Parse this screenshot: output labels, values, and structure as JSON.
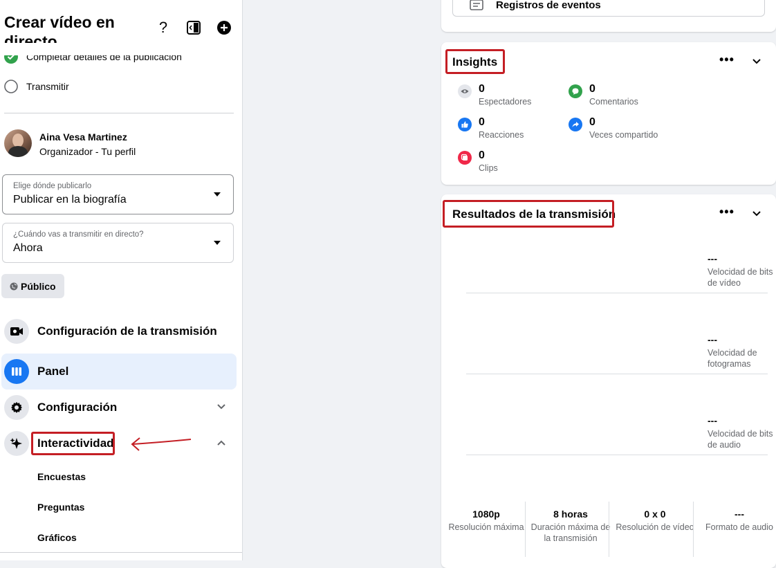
{
  "left": {
    "title_line1": "Crear vídeo en",
    "title_line2": "directo",
    "steps": {
      "completed": "Completar detalles de la publicación",
      "broadcast": "Transmitir"
    },
    "profile": {
      "name": "Aina Vesa Martinez",
      "role": "Organizador - Tu perfil"
    },
    "where": {
      "label": "Elige dónde publicarlo",
      "value": "Publicar en la biografía"
    },
    "when": {
      "label": "¿Cuándo vas a transmitir en directo?",
      "value": "Ahora"
    },
    "audience": "Público",
    "nav": {
      "stream_config": "Configuración de la transmisión",
      "panel": "Panel",
      "settings": "Configuración",
      "interactivity": "Interactividad"
    },
    "sub": {
      "polls": "Encuestas",
      "questions": "Preguntas",
      "graphics": "Gráficos"
    }
  },
  "top_card": {
    "label": "Registros de eventos"
  },
  "insights": {
    "title": "Insights",
    "items": {
      "viewers": {
        "value": "0",
        "label": "Espectadores"
      },
      "comments": {
        "value": "0",
        "label": "Comentarios"
      },
      "reactions": {
        "value": "0",
        "label": "Reacciones"
      },
      "shares": {
        "value": "0",
        "label": "Veces compartido"
      },
      "clips": {
        "value": "0",
        "label": "Clips"
      }
    }
  },
  "results": {
    "title": "Resultados de la transmisión",
    "metrics": [
      {
        "value": "---",
        "label": "Velocidad de bits de vídeo"
      },
      {
        "value": "---",
        "label": "Velocidad de fotogramas"
      },
      {
        "value": "---",
        "label": "Velocidad de bits de audio"
      }
    ],
    "footer": [
      {
        "value": "1080p",
        "label": "Resolución máxima"
      },
      {
        "value": "8 horas",
        "label": "Duración máxima de la transmisión"
      },
      {
        "value": "0 x 0",
        "label": "Resolución de vídeo"
      },
      {
        "value": "---",
        "label": "Formato de audio"
      }
    ]
  },
  "colors": {
    "accent": "#1877f2",
    "annotation_red": "#c41e24",
    "success_green": "#31a24c",
    "selected_bg": "#e7f0fd"
  }
}
